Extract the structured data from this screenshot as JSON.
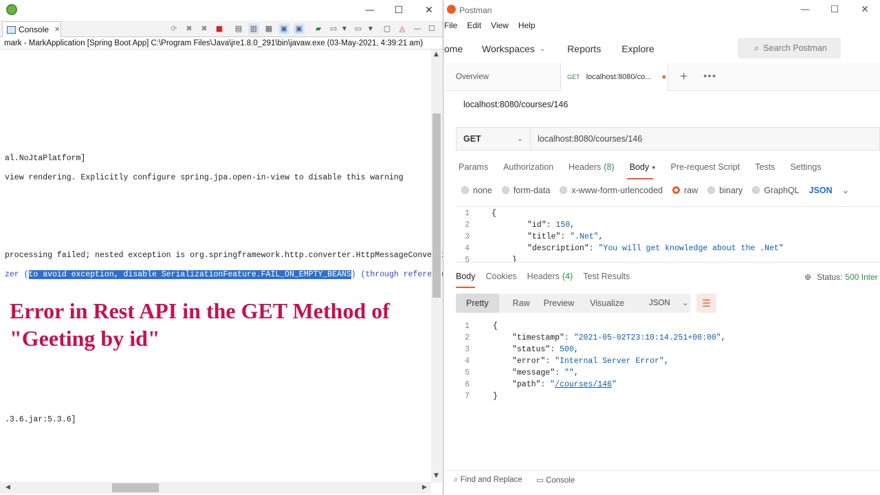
{
  "eclipse": {
    "console_tab_label": "Console",
    "status_line": "mark - MarkApplication [Spring Boot App] C:\\Program Files\\Java\\jre1.8.0_291\\bin\\javaw.exe (03-May-2021, 4:39:21 am)",
    "log_lines": {
      "l1": "al.NoJtaPlatform]",
      "l2": " view rendering. Explicitly configure spring.jpa.open-in-view to disable this warning",
      "l3": " processing failed; nested exception is org.springframework.http.converter.HttpMessageConversio",
      "l4_pre": "zer (",
      "l4_sel": "to avoid exception, disable SerializationFeature.FAIL_ON_EMPTY_BEANS",
      "l4_post": ") (through reference c",
      "l5": ".3.6.jar:5.3.6]"
    },
    "overlay_heading_line1": "Error in Rest API in the GET Method of",
    "overlay_heading_line2": "\"Geeting by id\""
  },
  "postman": {
    "window_title": "Postman",
    "menu": [
      "File",
      "Edit",
      "View",
      "Help"
    ],
    "nav": {
      "home": "ome",
      "workspaces": "Workspaces",
      "reports": "Reports",
      "explore": "Explore"
    },
    "search_placeholder": "Search Postman",
    "tabs": {
      "overview": "Overview",
      "request_method": "GET",
      "request_label": "localhost:8080/co..."
    },
    "request_title": "localhost:8080/courses/146",
    "method": "GET",
    "url": "localhost:8080/courses/146",
    "request_tabs": {
      "params": "Params",
      "authorization": "Authorization",
      "headers": "Headers",
      "headers_count": "(8)",
      "body": "Body",
      "prerequest": "Pre-request Script",
      "tests": "Tests",
      "settings": "Settings"
    },
    "body_types": {
      "none": "none",
      "formdata": "form-data",
      "urlencoded": "x-www-form-urlencoded",
      "raw": "raw",
      "binary": "binary",
      "graphql": "GraphQL",
      "json": "JSON"
    },
    "request_body": {
      "line1": "{",
      "id_key": "\"id\"",
      "id_val": "150",
      "title_key": "\"title\"",
      "title_val": "\".Net\"",
      "desc_key": "\"description\"",
      "desc_val": "\"You will get knowledge about the .Net\"",
      "line5": "}"
    },
    "response_tabs": {
      "body": "Body",
      "cookies": "Cookies",
      "headers": "Headers",
      "headers_count": "(4)",
      "test_results": "Test Results"
    },
    "status_label": "Status:",
    "status_value": "500 Inter",
    "format_tabs": {
      "pretty": "Pretty",
      "raw": "Raw",
      "preview": "Preview",
      "visualize": "Visualize"
    },
    "response_format": "JSON",
    "response_body": {
      "open": "{",
      "timestamp_key": "\"timestamp\"",
      "timestamp_val": "\"2021-05-02T23:10:14.251+00:00\"",
      "status_key": "\"status\"",
      "status_val": "500",
      "error_key": "\"error\"",
      "error_val": "\"Internal Server Error\"",
      "message_key": "\"message\"",
      "message_val": "\"\"",
      "path_key": "\"path\"",
      "path_q1": "\"",
      "path_val": "/courses/146",
      "path_q2": "\"",
      "close": "}"
    },
    "footer": {
      "find_replace": "Find and Replace",
      "console": "Console"
    },
    "colors": {
      "accent": "#ef5b25",
      "link": "#0b5ea8",
      "heading": "#c8104e",
      "selection": "#2f6fd0"
    }
  }
}
